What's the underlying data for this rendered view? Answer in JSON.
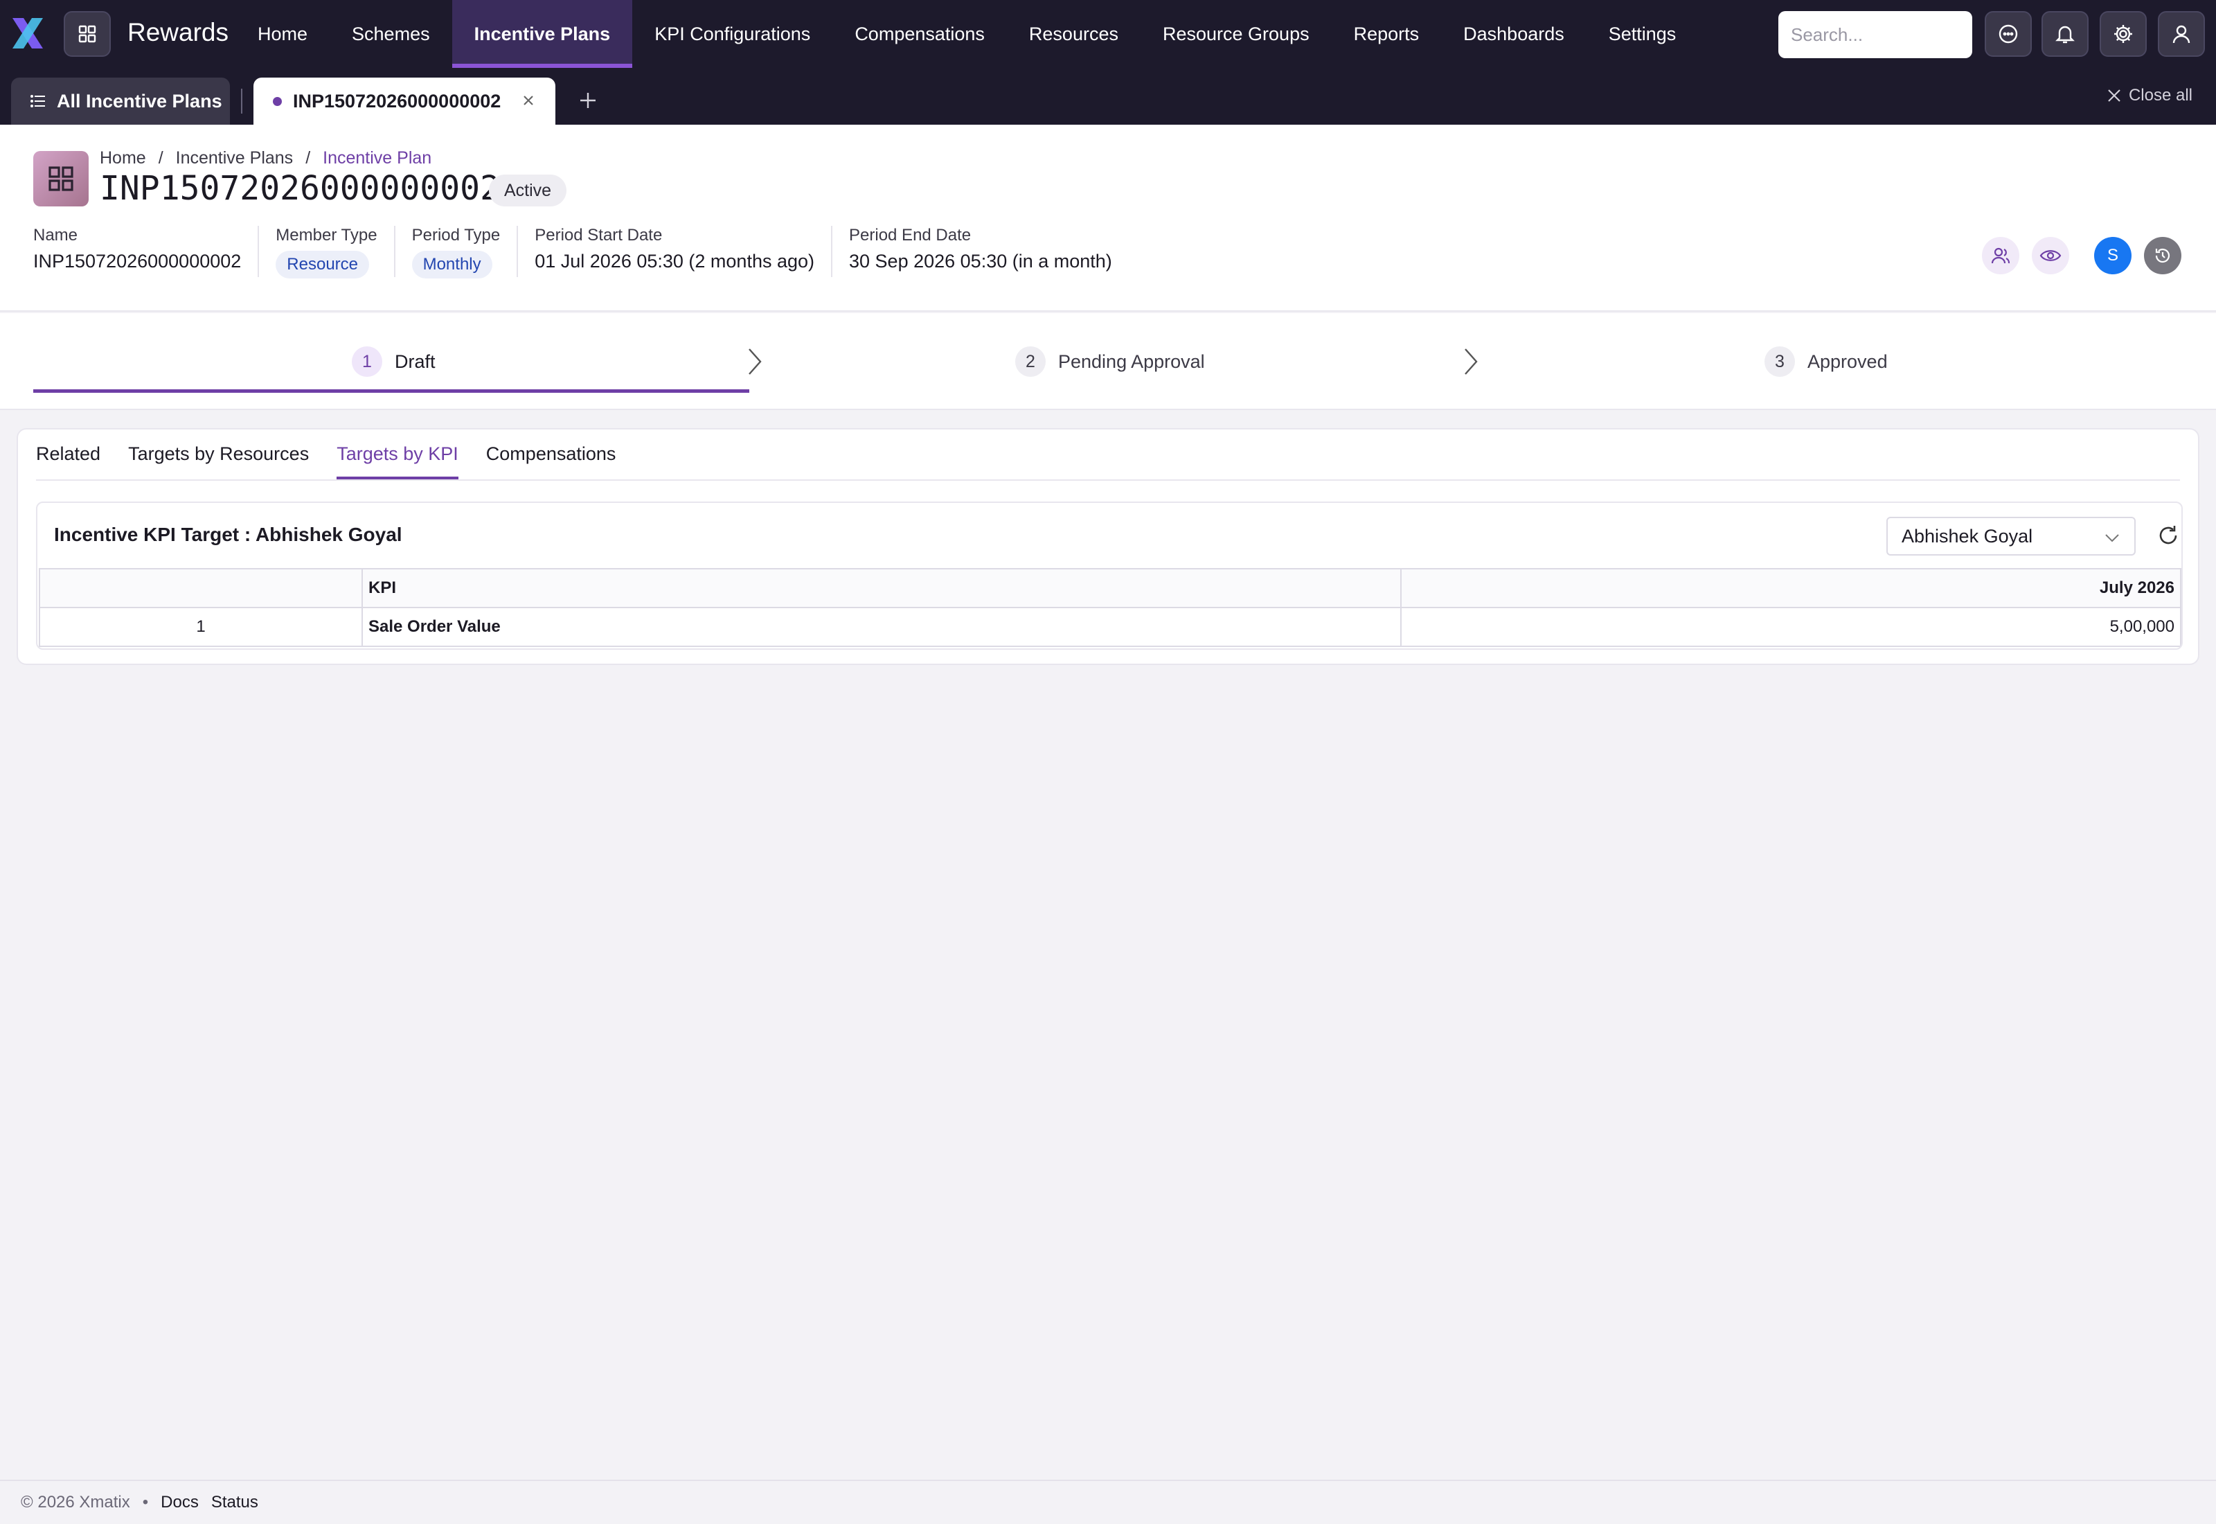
{
  "app": {
    "name": "Rewards"
  },
  "nav": {
    "items": [
      {
        "label": "Home",
        "name": "nav-home",
        "active": false
      },
      {
        "label": "Schemes",
        "name": "nav-schemes",
        "active": false
      },
      {
        "label": "Incentive Plans",
        "name": "nav-incentive-plans",
        "active": true
      },
      {
        "label": "KPI Configurations",
        "name": "nav-kpi-configurations",
        "active": false
      },
      {
        "label": "Compensations",
        "name": "nav-compensations",
        "active": false
      },
      {
        "label": "Resources",
        "name": "nav-resources",
        "active": false
      },
      {
        "label": "Resource Groups",
        "name": "nav-resource-groups",
        "active": false
      },
      {
        "label": "Reports",
        "name": "nav-reports",
        "active": false
      },
      {
        "label": "Dashboards",
        "name": "nav-dashboards",
        "active": false
      },
      {
        "label": "Settings",
        "name": "nav-settings",
        "active": false
      }
    ],
    "search_placeholder": "Search..."
  },
  "tabstrip": {
    "all_label": "All Incentive Plans",
    "doc_label": "INP15072026000000002",
    "close_all": "Close all"
  },
  "header": {
    "breadcrumb": [
      "Home",
      "Incentive Plans",
      "Incentive Plan"
    ],
    "title": "INP15072026000000002",
    "status": "Active",
    "fields": {
      "name_label": "Name",
      "name_value": "INP15072026000000002",
      "member_type_label": "Member Type",
      "member_type_value": "Resource",
      "period_type_label": "Period Type",
      "period_type_value": "Monthly",
      "start_label": "Period Start Date",
      "start_value": "01 Jul 2026 05:30 (2 months ago)",
      "end_label": "Period End Date",
      "end_value": "30 Sep 2026 05:30 (in a month)"
    },
    "avatar_initial": "S"
  },
  "stepper": {
    "steps": [
      {
        "num": "1",
        "label": "Draft"
      },
      {
        "num": "2",
        "label": "Pending Approval"
      },
      {
        "num": "3",
        "label": "Approved"
      }
    ],
    "active_index": 0
  },
  "content": {
    "tabs": [
      "Related",
      "Targets by Resources",
      "Targets by KPI",
      "Compensations"
    ],
    "active_tab": 2,
    "panel_title": "Incentive KPI Target : Abhishek Goyal",
    "resource_select": "Abhishek Goyal",
    "table": {
      "headers": [
        "",
        "KPI",
        "July 2026"
      ],
      "rows": [
        [
          "1",
          "Sale Order Value",
          "5,00,000"
        ]
      ]
    }
  },
  "footer": {
    "copyright": "© 2026 Xmatix",
    "sep": "•",
    "docs": "Docs",
    "status": "Status"
  },
  "colors": {
    "nav_bg": "#1d1a2c",
    "accent": "#6e3fa6",
    "avatar": "#1877f2"
  }
}
